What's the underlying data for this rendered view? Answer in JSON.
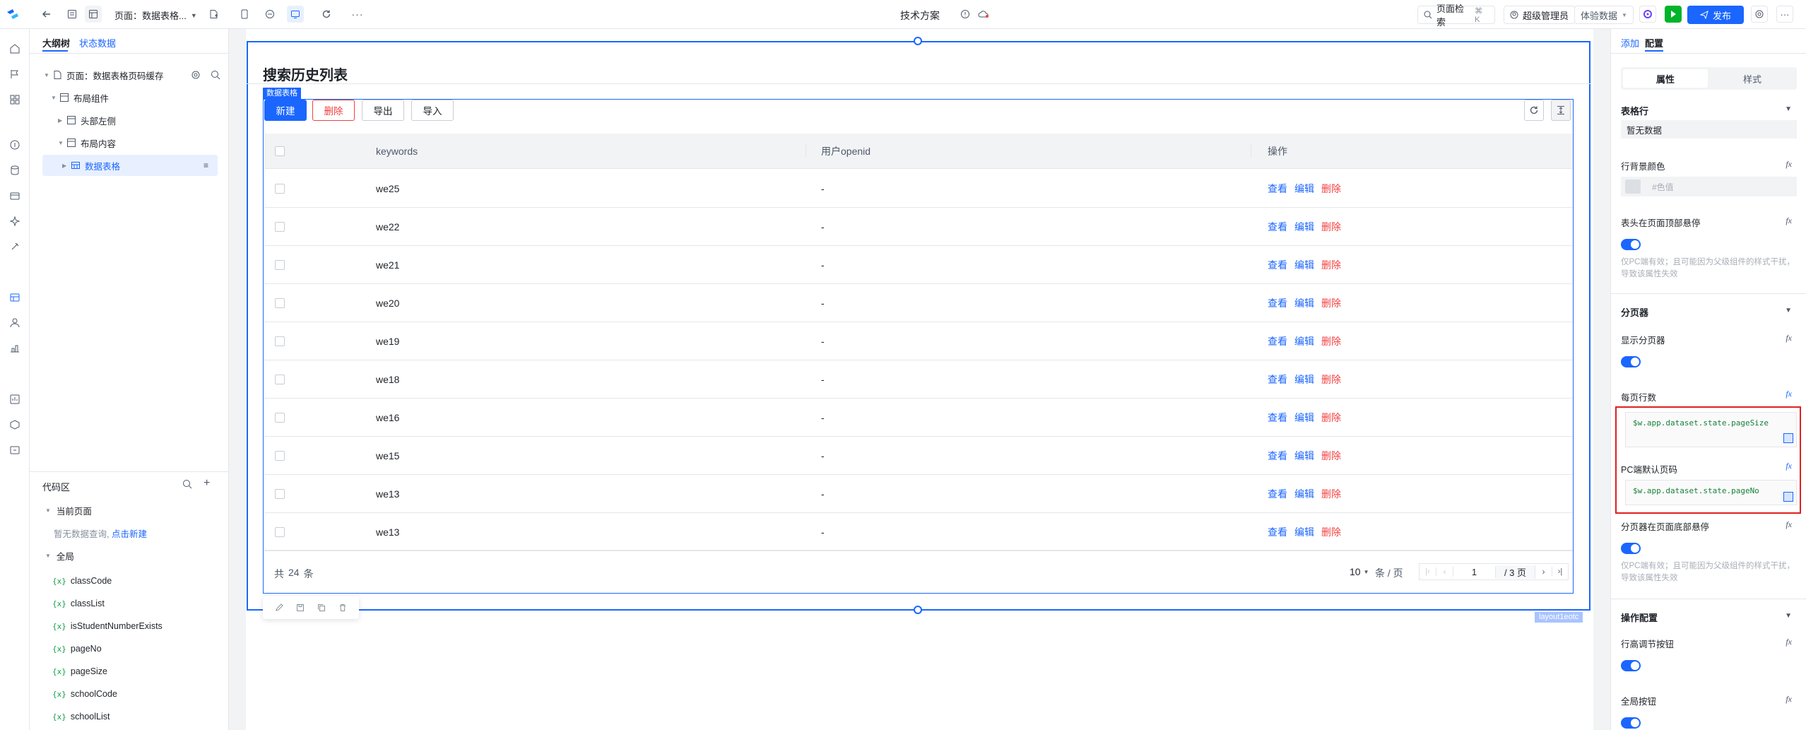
{
  "topbar": {
    "page_label": "页面：数据表格...",
    "center_title": "技术方案",
    "search_label": "页面检索",
    "search_shortcut": "⌘ K",
    "admin_label": "超级管理员",
    "data_mode": "体验数据",
    "publish_label": "发布"
  },
  "left_panel": {
    "tabs": [
      "大纲树",
      "状态数据"
    ],
    "tree": [
      {
        "label": "页面：数据表格页码缓存"
      },
      {
        "label": "布局组件"
      },
      {
        "label": "头部左侧"
      },
      {
        "label": "布局内容"
      },
      {
        "label": "数据表格"
      }
    ],
    "code_area_title": "代码区",
    "current_page": "当前页面",
    "empty_query": "暂无数据查询,",
    "create_link": "点击新建",
    "global_label": "全局",
    "variables": [
      "classCode",
      "classList",
      "isStudentNumberExists",
      "pageNo",
      "pageSize",
      "schoolCode",
      "schoolList"
    ]
  },
  "canvas": {
    "page_title": "搜索历史列表",
    "component_tag": "数据表格",
    "layout_tag": "layout1eotc",
    "buttons": {
      "new": "新建",
      "delete": "删除",
      "export": "导出",
      "import": "导入"
    },
    "columns": [
      "keywords",
      "用户openid",
      "操作"
    ],
    "rows": [
      {
        "keywords": "we25",
        "openid": "-"
      },
      {
        "keywords": "we22",
        "openid": "-"
      },
      {
        "keywords": "we21",
        "openid": "-"
      },
      {
        "keywords": "we20",
        "openid": "-"
      },
      {
        "keywords": "we19",
        "openid": "-"
      },
      {
        "keywords": "we18",
        "openid": "-"
      },
      {
        "keywords": "we16",
        "openid": "-"
      },
      {
        "keywords": "we15",
        "openid": "-"
      },
      {
        "keywords": "we13",
        "openid": "-"
      },
      {
        "keywords": "we13",
        "openid": "-"
      }
    ],
    "actions": {
      "view": "查看",
      "edit": "编辑",
      "delete": "删除"
    },
    "pager": {
      "total_prefix": "共",
      "total": "24",
      "total_suffix": "条",
      "page_size": "10",
      "per_page": "条 / 页",
      "current_page": "1",
      "pages_label": "/ 3 页"
    }
  },
  "right_panel": {
    "tabs": [
      "添加",
      "配置"
    ],
    "segments": [
      "属性",
      "样式"
    ],
    "table_row_section": "表格行",
    "no_data": "暂无数据",
    "row_bg_label": "行背景颜色",
    "color_placeholder": "#色值",
    "sticky_header_label": "表头在页面顶部悬停",
    "pc_hint": "仅PC端有效；且可能因为父级组件的样式干扰，导致该属性失效",
    "pager_section": "分页器",
    "show_pager_label": "显示分页器",
    "rows_per_page_label": "每页行数",
    "rows_per_page_expr": "$w.app.dataset.state.pageSize",
    "default_page_label": "PC端默认页码",
    "default_page_expr": "$w.app.dataset.state.pageNo",
    "pager_sticky_label": "分页器在页面底部悬停",
    "ops_section": "操作配置",
    "row_height_btn_label": "行高调节按钮",
    "global_btn_label": "全局按钮"
  },
  "colors": {
    "accent": "#1a66ff",
    "danger": "#f53f3f",
    "highlight": "#e8f0ff",
    "publish_green": "#00b42a"
  }
}
